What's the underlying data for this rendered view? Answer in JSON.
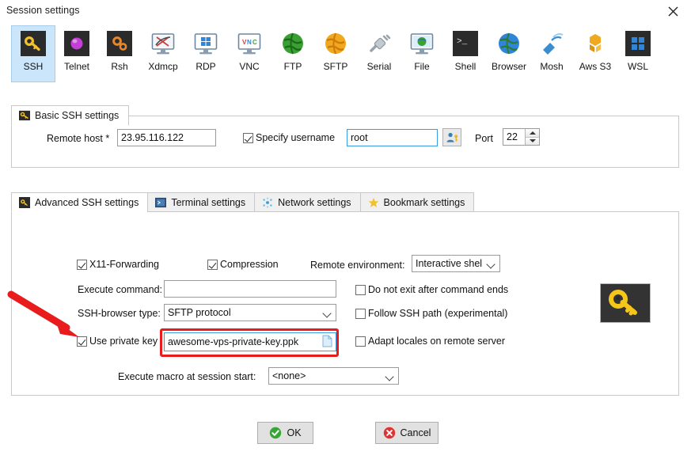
{
  "window": {
    "title": "Session settings",
    "close_label": "Close"
  },
  "session_types": [
    {
      "label": "SSH",
      "icon": "ssh-key-icon",
      "selected": true
    },
    {
      "label": "Telnet",
      "icon": "telnet-icon",
      "selected": false
    },
    {
      "label": "Rsh",
      "icon": "rsh-gears-icon",
      "selected": false
    },
    {
      "label": "Xdmcp",
      "icon": "xdmcp-monitor-icon",
      "selected": false
    },
    {
      "label": "RDP",
      "icon": "rdp-monitor-icon",
      "selected": false
    },
    {
      "label": "VNC",
      "icon": "vnc-monitor-icon",
      "selected": false
    },
    {
      "label": "FTP",
      "icon": "ftp-globe-icon",
      "selected": false
    },
    {
      "label": "SFTP",
      "icon": "sftp-globe-icon",
      "selected": false
    },
    {
      "label": "Serial",
      "icon": "serial-plug-icon",
      "selected": false
    },
    {
      "label": "File",
      "icon": "file-monitor-icon",
      "selected": false
    },
    {
      "label": "Shell",
      "icon": "shell-terminal-icon",
      "selected": false
    },
    {
      "label": "Browser",
      "icon": "browser-globe-icon",
      "selected": false
    },
    {
      "label": "Mosh",
      "icon": "mosh-satellite-icon",
      "selected": false
    },
    {
      "label": "Aws S3",
      "icon": "aws-s3-icon",
      "selected": false
    },
    {
      "label": "WSL",
      "icon": "wsl-windows-icon",
      "selected": false
    }
  ],
  "basic": {
    "tab_label": "Basic SSH settings",
    "remote_host_label": "Remote host *",
    "remote_host_value": "23.95.116.122",
    "specify_username_label": "Specify username",
    "specify_username_checked": true,
    "username_value": "root",
    "port_label": "Port",
    "port_value": "22"
  },
  "tabs": [
    {
      "label": "Advanced SSH settings",
      "icon": "ssh-key-icon",
      "active": true
    },
    {
      "label": "Terminal settings",
      "icon": "terminal-icon",
      "active": false
    },
    {
      "label": "Network settings",
      "icon": "network-dots-icon",
      "active": false
    },
    {
      "label": "Bookmark settings",
      "icon": "star-icon",
      "active": false
    }
  ],
  "advanced": {
    "x11_label": "X11-Forwarding",
    "x11_checked": true,
    "compression_label": "Compression",
    "compression_checked": true,
    "remote_env_label": "Remote environment:",
    "remote_env_value": "Interactive shell",
    "execute_command_label": "Execute command:",
    "execute_command_value": "",
    "do_not_exit_label": "Do not exit after command ends",
    "do_not_exit_checked": false,
    "ssh_browser_label": "SSH-browser type:",
    "ssh_browser_value": "SFTP protocol",
    "follow_ssh_label": "Follow SSH path (experimental)",
    "follow_ssh_checked": false,
    "use_private_key_label": "Use private key",
    "use_private_key_checked": true,
    "private_key_value": "awesome-vps-private-key.ppk",
    "adapt_locales_label": "Adapt locales on remote server",
    "adapt_locales_checked": false,
    "macro_label": "Execute macro at session start:",
    "macro_value": "<none>"
  },
  "buttons": {
    "ok_label": "OK",
    "cancel_label": "Cancel"
  },
  "colors": {
    "selection_blue": "#cbe5fa",
    "focus_blue": "#3b9ae1",
    "annotation_red": "#e81c1c",
    "ok_green": "#34a833",
    "cancel_red": "#dd3333",
    "key_yellow": "#f5c518"
  }
}
